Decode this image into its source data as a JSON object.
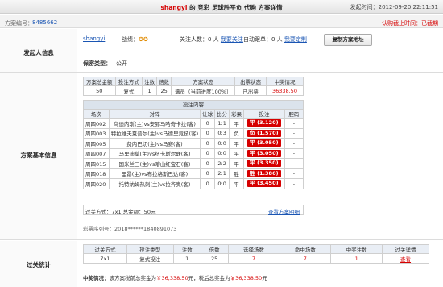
{
  "header": {
    "username": "shangyi",
    "title_rest": "的 竞彩 足球胜平负 代购 方案详情",
    "time_label": "发起时间：",
    "time_value": "2012-09-20 22:11:51"
  },
  "scheme": {
    "label": "方案编号：",
    "number": "8485662",
    "deadline": "认购截止时间：已截期"
  },
  "sponsor": {
    "section_label": "发起人信息",
    "username": "shangyi",
    "record_label": "战绩：",
    "record_icons": "✪✪",
    "follow_text": "关注人数：",
    "follow_count": "0 人",
    "follow_link": "我要关注",
    "auto_text": "自动跟单：",
    "auto_count": "0 人",
    "auto_link": "我要定制",
    "copy_button": "复制方案地址",
    "secret_label": "保密类型：",
    "secret_value": "公开"
  },
  "basic": {
    "section_label": "方案基本信息",
    "summary_headers": [
      "方案总金额",
      "投注方式",
      "注数",
      "倍数",
      "方案状态",
      "出票状态",
      "中奖情况"
    ],
    "summary_row": [
      "50",
      "复式",
      "1",
      "25",
      "满员（当前进度100%）",
      "已出票",
      "36338.50"
    ],
    "content_title": "投注内容",
    "match_headers": [
      "场次",
      "对阵",
      "让球",
      "比分",
      "彩果",
      "投注",
      "胆码"
    ],
    "matches": [
      {
        "id": "周四002",
        "vs": "乌迪内斯(主)vs安郅马哈奇卡拉(客)",
        "hc": "0",
        "score": "1:1",
        "res": "平",
        "pick": "平 (3.120)",
        "dan": "-"
      },
      {
        "id": "周四003",
        "vs": "特拉维夫夏普尔(主)vs马德里竞技(客)",
        "hc": "0",
        "score": "0:3",
        "res": "负",
        "pick": "负 (1.570)",
        "dan": "-"
      },
      {
        "id": "周四005",
        "vs": "费内巴切(主)vs马赛(客)",
        "hc": "0",
        "score": "0:0",
        "res": "平",
        "pick": "平 (3.050)",
        "dan": "-"
      },
      {
        "id": "周四007",
        "vs": "马里迪莫(主)vs纽卡斯尔联(客)",
        "hc": "0",
        "score": "0:0",
        "res": "平",
        "pick": "平 (3.050)",
        "dan": "-"
      },
      {
        "id": "周四015",
        "vs": "国米兰三(主)vs喀山红宝石(客)",
        "hc": "0",
        "score": "2:2",
        "res": "平",
        "pick": "平 (3.350)",
        "dan": "-"
      },
      {
        "id": "周四018",
        "vs": "里昂(主)vs布拉格斯巴达(客)",
        "hc": "0",
        "score": "2:1",
        "res": "胜",
        "pick": "胜 (1.380)",
        "dan": "-"
      },
      {
        "id": "周四020",
        "vs": "托特纳姆热刺(主)vs拉齐奥(客)",
        "hc": "0",
        "score": "0:0",
        "res": "平",
        "pick": "平 (3.450)",
        "dan": "-"
      }
    ],
    "foot_left": "过关方式：7x1 总金额：50元",
    "foot_link": "查看方案明细",
    "serial_label": "彩票序列号：",
    "serial_value": "2018******1840891073"
  },
  "stats": {
    "section_label": "过关统计",
    "headers": [
      "过关方式",
      "投注类型",
      "注数",
      "倍数",
      "选择场数",
      "命中场数",
      "中奖注数",
      "过关详情"
    ],
    "row": [
      "7x1",
      "复式投注",
      "1",
      "25",
      "7",
      "7",
      "1",
      "查看"
    ],
    "prize_label": "中奖情况：",
    "prize_text_1": "该方案税前总奖金为",
    "prize_pre": "￥36,338.50",
    "prize_text_2": "元，税后总奖金为",
    "prize_post": "￥36,338.50",
    "prize_text_3": "元"
  }
}
